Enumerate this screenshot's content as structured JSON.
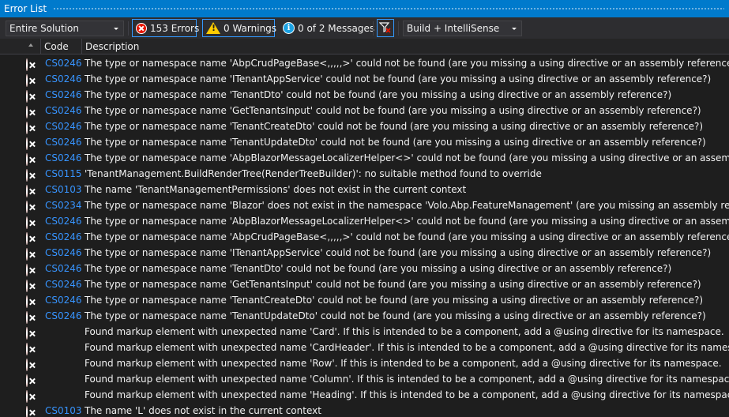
{
  "window": {
    "title": "Error List"
  },
  "toolbar": {
    "scope": "Entire Solution",
    "errors_label": "153 Errors",
    "warnings_label": "0 Warnings",
    "messages_label": "0 of 2 Messages",
    "build_filter": "Build + IntelliSense"
  },
  "columns": {
    "code": "Code",
    "description": "Description"
  },
  "colors": {
    "accent": "#007acc",
    "error": "#e51400",
    "code_link": "#3794ff",
    "background": "#1e1e1e"
  },
  "rows": [
    {
      "code": "CS0246",
      "description": "The type or namespace name 'AbpCrudPageBase<,,,,,>' could not be found (are you missing a using directive or an assembly reference?)"
    },
    {
      "code": "CS0246",
      "description": "The type or namespace name 'ITenantAppService' could not be found (are you missing a using directive or an assembly reference?)"
    },
    {
      "code": "CS0246",
      "description": "The type or namespace name 'TenantDto' could not be found (are you missing a using directive or an assembly reference?)"
    },
    {
      "code": "CS0246",
      "description": "The type or namespace name 'GetTenantsInput' could not be found (are you missing a using directive or an assembly reference?)"
    },
    {
      "code": "CS0246",
      "description": "The type or namespace name 'TenantCreateDto' could not be found (are you missing a using directive or an assembly reference?)"
    },
    {
      "code": "CS0246",
      "description": "The type or namespace name 'TenantUpdateDto' could not be found (are you missing a using directive or an assembly reference?)"
    },
    {
      "code": "CS0246",
      "description": "The type or namespace name 'AbpBlazorMessageLocalizerHelper<>' could not be found (are you missing a using directive or an assembly reference?)"
    },
    {
      "code": "CS0115",
      "description": "'TenantManagement.BuildRenderTree(RenderTreeBuilder)': no suitable method found to override"
    },
    {
      "code": "CS0103",
      "description": "The name 'TenantManagementPermissions' does not exist in the current context"
    },
    {
      "code": "CS0234",
      "description": "The type or namespace name 'Blazor' does not exist in the namespace 'Volo.Abp.FeatureManagement' (are you missing an assembly reference?)"
    },
    {
      "code": "CS0246",
      "description": "The type or namespace name 'AbpBlazorMessageLocalizerHelper<>' could not be found (are you missing a using directive or an assembly reference?)"
    },
    {
      "code": "CS0246",
      "description": "The type or namespace name 'AbpCrudPageBase<,,,,,>' could not be found (are you missing a using directive or an assembly reference?)"
    },
    {
      "code": "CS0246",
      "description": "The type or namespace name 'ITenantAppService' could not be found (are you missing a using directive or an assembly reference?)"
    },
    {
      "code": "CS0246",
      "description": "The type or namespace name 'TenantDto' could not be found (are you missing a using directive or an assembly reference?)"
    },
    {
      "code": "CS0246",
      "description": "The type or namespace name 'GetTenantsInput' could not be found (are you missing a using directive or an assembly reference?)"
    },
    {
      "code": "CS0246",
      "description": "The type or namespace name 'TenantCreateDto' could not be found (are you missing a using directive or an assembly reference?)"
    },
    {
      "code": "CS0246",
      "description": "The type or namespace name 'TenantUpdateDto' could not be found (are you missing a using directive or an assembly reference?)"
    },
    {
      "code": "",
      "description": "Found markup element with unexpected name 'Card'. If this is intended to be a component, add a @using directive for its namespace."
    },
    {
      "code": "",
      "description": "Found markup element with unexpected name 'CardHeader'. If this is intended to be a component, add a @using directive for its namespace."
    },
    {
      "code": "",
      "description": "Found markup element with unexpected name 'Row'. If this is intended to be a component, add a @using directive for its namespace."
    },
    {
      "code": "",
      "description": "Found markup element with unexpected name 'Column'. If this is intended to be a component, add a @using directive for its namespace."
    },
    {
      "code": "",
      "description": "Found markup element with unexpected name 'Heading'. If this is intended to be a component, add a @using directive for its namespace."
    },
    {
      "code": "CS0103",
      "description": "The name 'L' does not exist in the current context"
    }
  ]
}
